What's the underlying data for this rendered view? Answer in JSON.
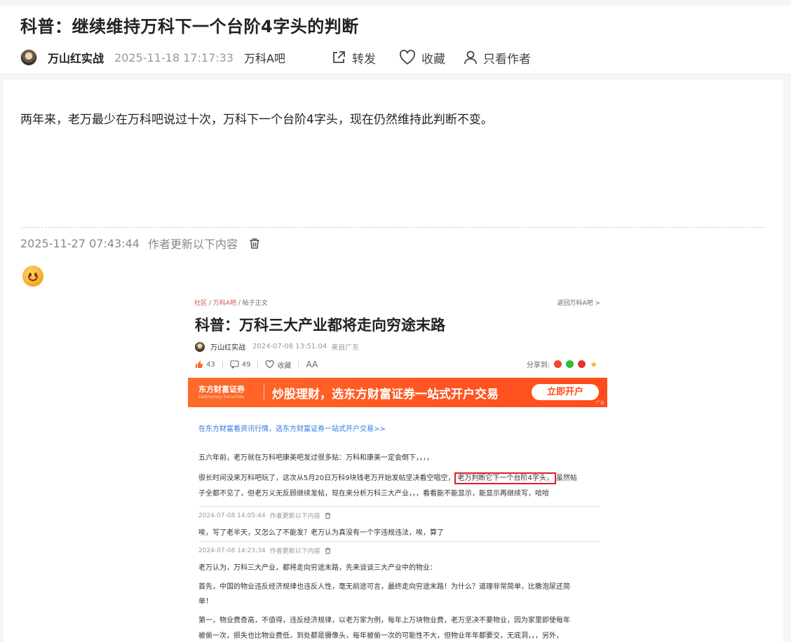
{
  "post": {
    "title": "科普：继续维持万科下一个台阶4字头的判断",
    "author": "万山红实战",
    "datetime": "2025-11-18 17:17:33",
    "bar": "万科A吧"
  },
  "actions": {
    "forward_label": "转发",
    "favorite_label": "收藏",
    "author_only_label": "只看作者"
  },
  "body": {
    "intro": "两年来，老万最少在万科吧说过十次，万科下一个台阶4字头，现在仍然维持此判断不变。",
    "update_time": "2025-11-27 07:43:44",
    "update_label": "作者更新以下内容"
  },
  "screenshot": {
    "breadcrumb_1": "社区",
    "breadcrumb_2": "万科A吧",
    "breadcrumb_3": "帖子正文",
    "back_label": "返回万科A吧 >",
    "title": "科普：万科三大产业都将走向穷途末路",
    "author": "万山红实战",
    "datetime": "2024-07-08 13:51:04",
    "location": "来自广东",
    "likes": "43",
    "comments": "49",
    "favorite_label": "收藏",
    "font_label": "AA",
    "share_label": "分享到:",
    "banner": {
      "logo": "东方财富证券",
      "logo_sub": "Eastmoney Securities",
      "slogan": "炒股理财，选东方财富证券一站式开户交易",
      "button": "立即开户",
      "ad": "广告"
    },
    "link": "在东方财富看资讯行情，选东方财富证券一站式开户交易>>",
    "para1": "五六年前，老万就在万科吧康美吧发过很多贴：万科和康美一定会倒下，，，，",
    "para2_before": "很长时间没来万科吧玩了，这次从5月20日万科9块钱老万开始发帖坚决看空唱空，",
    "para2_highlight": "老万判断它下一个台阶4字头，",
    "para2_after": "虽然帖",
    "para3": "子全都不见了，但老万义无反顾继续发帖，现在来分析万科三大产业，，，看看能不能显示，能显示再继续写，哈哈",
    "update1_time": "2024-07-08 14:05:44",
    "update1_label": "作者更新以下内容",
    "update1_text": "唉，写了老半天，又怎么了不能发？老万认为真没有一个字违规违法，唉，算了",
    "update2_time": "2024-07-08 14:23:34",
    "update2_label": "作者更新以下内容",
    "update2_text1": "老万认为，万科三大产业，都将走向穷途末路，先来谈谈三大产业中的物业：",
    "update2_text2": "首先，中国的物业违反经济规律也违反人性，毫无前途可言，最终走向穷途末路！为什么？道理非常简单，比撒泡尿还简",
    "update2_text3": "单！",
    "update2_text4": "第一，物业费奇高，不值得，违反经济规律，以老万家为例，每年上万块物业费，老万坚决不要物业，因为家里即使每年",
    "update2_text5": "被偷一次，损失也比物业费低，到处都是摄像头，每年被偷一次的可能性不大，但物业年年都要交，无底洞，，，另外，"
  },
  "colors": {
    "banner_orange": "#ff5522",
    "highlight_red": "#e02020",
    "link_blue": "#2a7ae2"
  }
}
